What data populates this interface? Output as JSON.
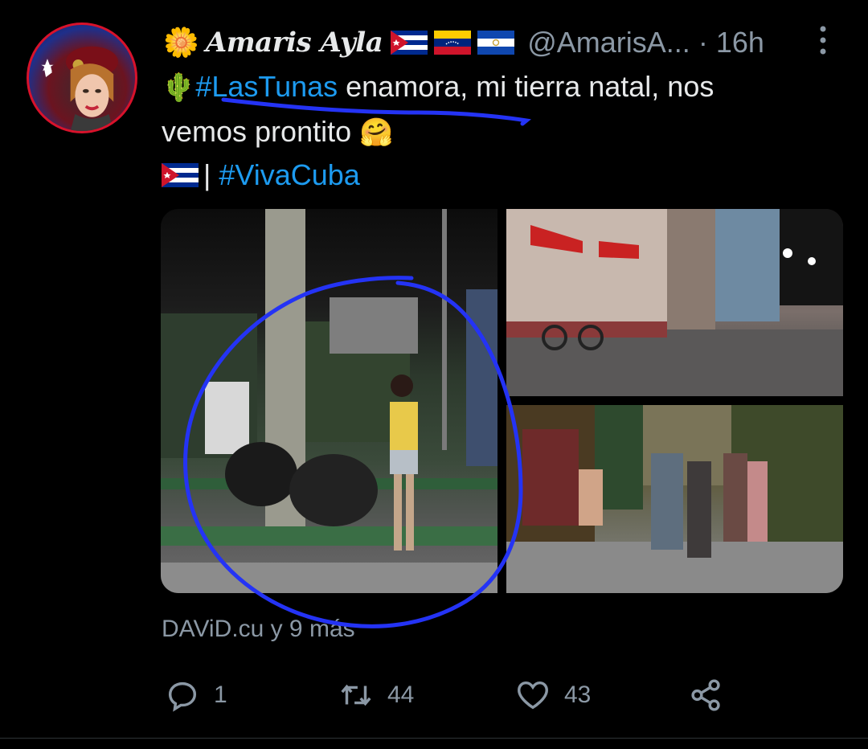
{
  "author": {
    "display_name": "Amaris Ayla",
    "handle": "@AmarisA...",
    "separator": "·",
    "time": "16h",
    "name_emoji": "🌼",
    "flags": [
      "cuba-flag",
      "venezuela-flag",
      "el-salvador-flag"
    ]
  },
  "tweet": {
    "line1_emoji": "🌵",
    "line1_hashtag": "#LasTunas",
    "line1_text": " enamora, mi tierra natal, nos",
    "line2_text": "vemos prontito ",
    "line2_emoji": "🤗",
    "line3_sep": "| ",
    "line3_hashtag": "#VivaCuba"
  },
  "media": {
    "photos": [
      "park-night-photo",
      "street-night-photo",
      "sidewalk-night-photo"
    ]
  },
  "source": "DAViD.cu y 9 más",
  "actions": {
    "reply_count": "1",
    "retweet_count": "44",
    "like_count": "43"
  },
  "colors": {
    "background": "#000000",
    "text": "#e7e9ea",
    "secondary": "#8b98a5",
    "hashtag": "#1d9bf0",
    "annotation": "#2433f5"
  }
}
